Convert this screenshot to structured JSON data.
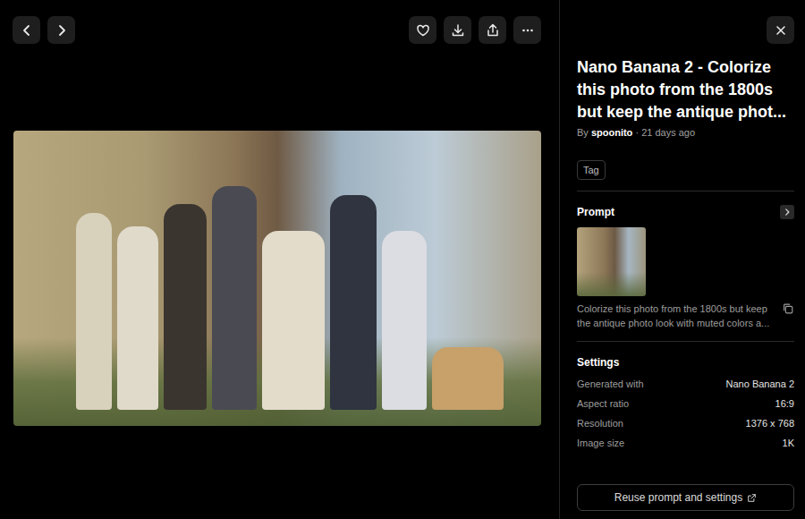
{
  "title": "Nano Banana 2 - Colorize this photo from the 1800s but keep the antique phot...",
  "byline": {
    "by": "By",
    "author": "spoonito",
    "separator": "·",
    "time": "21 days ago"
  },
  "tags": [
    "Tag"
  ],
  "prompt": {
    "label": "Prompt",
    "text": "Colorize this photo from the 1800s but keep the antique photo look with muted colors a..."
  },
  "settings": {
    "label": "Settings",
    "rows": [
      {
        "label": "Generated with",
        "value": "Nano Banana 2"
      },
      {
        "label": "Aspect ratio",
        "value": "16:9"
      },
      {
        "label": "Resolution",
        "value": "1376 x 768"
      },
      {
        "label": "Image size",
        "value": "1K"
      }
    ]
  },
  "reuse_button": "Reuse prompt and settings"
}
